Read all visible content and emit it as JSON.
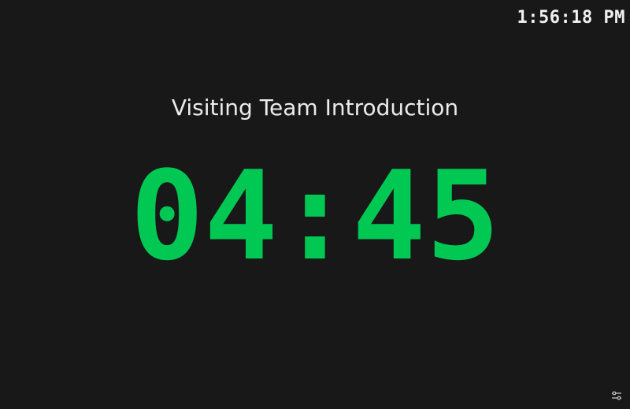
{
  "clock": {
    "time": "1:56:18 PM"
  },
  "segment": {
    "title": "Visiting Team Introduction"
  },
  "timer": {
    "display": "04:45"
  },
  "colors": {
    "background": "#181818",
    "timer": "#00c853",
    "text": "#ececec"
  },
  "icons": {
    "settings": "sliders-icon"
  }
}
